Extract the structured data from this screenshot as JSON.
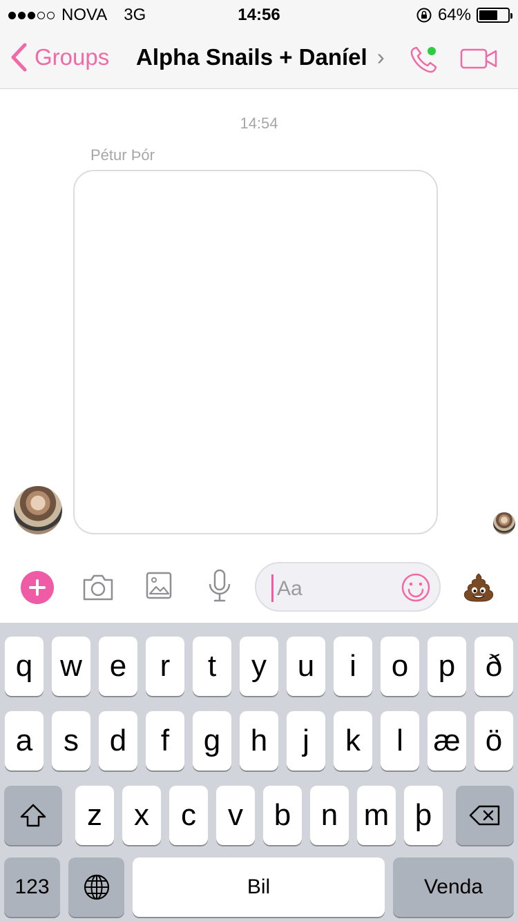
{
  "status_bar": {
    "carrier": "NOVA",
    "network": "3G",
    "time": "14:56",
    "battery": "64%",
    "battery_level": 0.64,
    "signal_bars_filled": 3,
    "signal_bars_total": 5
  },
  "nav": {
    "back_label": "Groups",
    "title": "Alpha Snails + Daníel",
    "title_chevron": "›",
    "accent_color": "#f06aa6"
  },
  "conversation": {
    "timestamp": "14:54",
    "sender_name": "Pétur Þór"
  },
  "composer": {
    "placeholder": "Aa",
    "icons": [
      "plus-icon",
      "camera-icon",
      "gallery-icon",
      "mic-icon",
      "smiley-icon",
      "poo-emoji-icon"
    ],
    "poo_emoji": "💩"
  },
  "keyboard": {
    "row1": [
      "q",
      "w",
      "e",
      "r",
      "t",
      "y",
      "u",
      "i",
      "o",
      "p",
      "ð"
    ],
    "row2": [
      "a",
      "s",
      "d",
      "f",
      "g",
      "h",
      "j",
      "k",
      "l",
      "æ",
      "ö"
    ],
    "row3": [
      "z",
      "x",
      "c",
      "v",
      "b",
      "n",
      "m",
      "þ"
    ],
    "numbers_label": "123",
    "space_label": "Bil",
    "return_label": "Venda"
  }
}
